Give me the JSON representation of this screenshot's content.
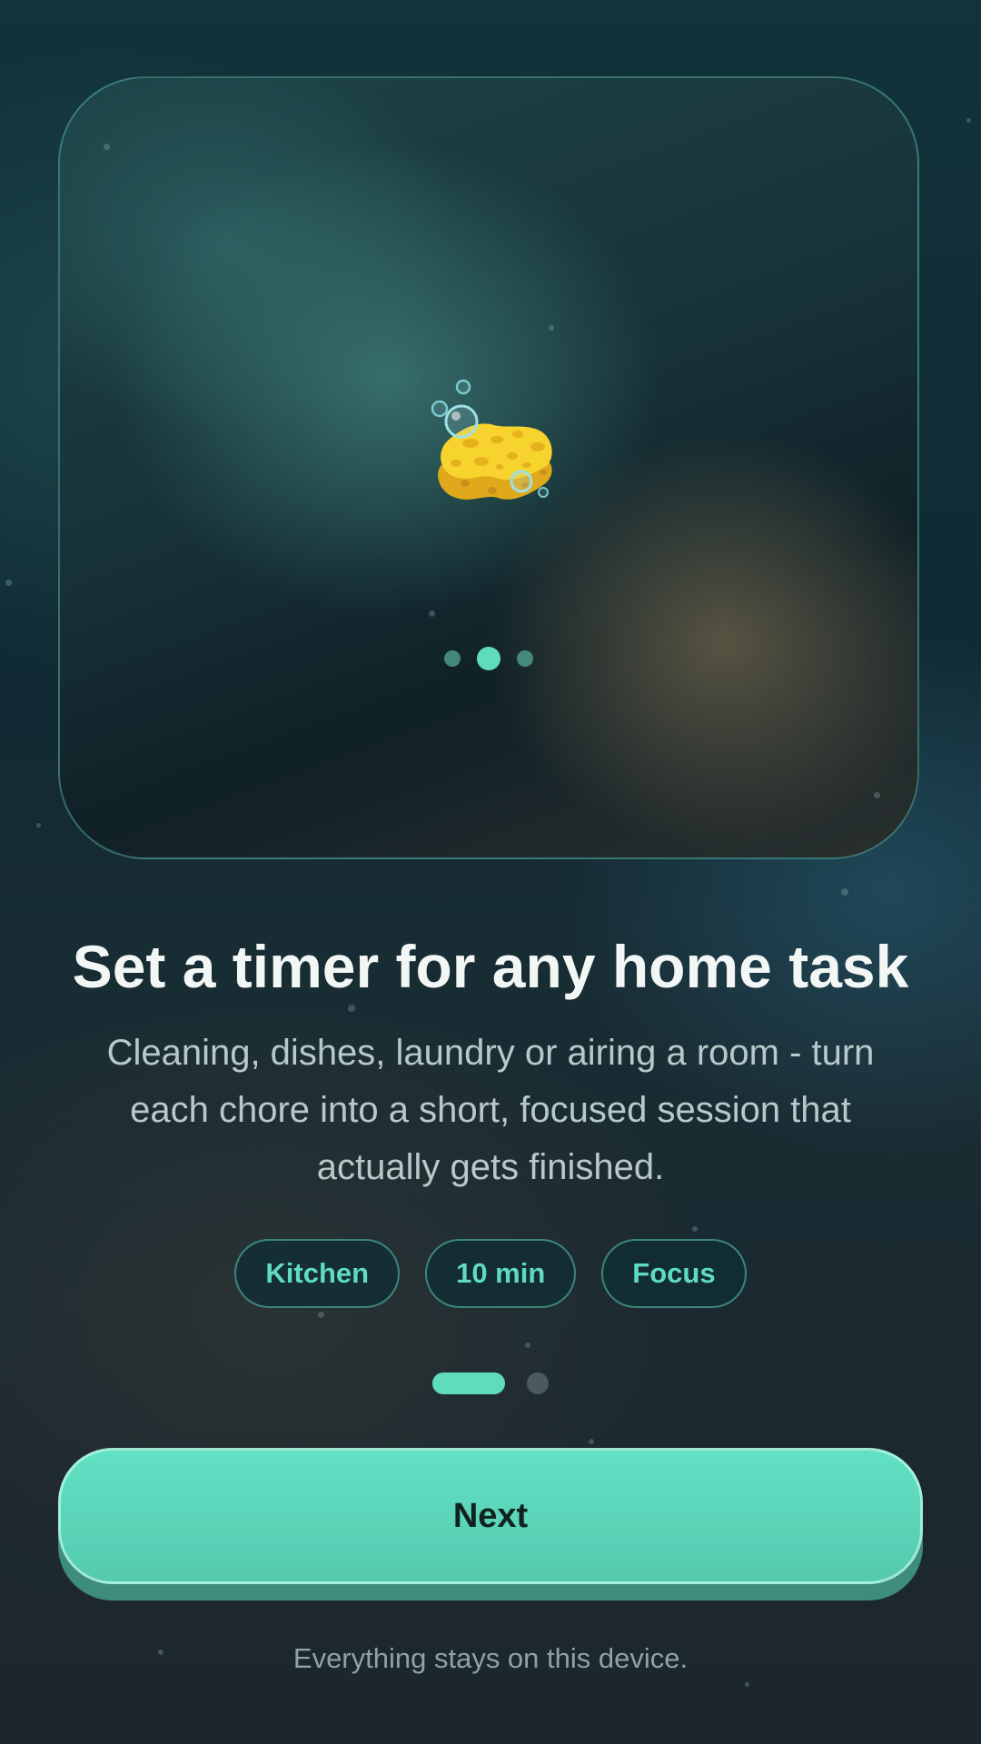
{
  "hero": {
    "icon": "sponge-with-bubbles",
    "carousel_dots": {
      "count": 3,
      "active_index": 1
    }
  },
  "content": {
    "title": "Set a timer for any home task",
    "subtitle": "Cleaning, dishes, laundry or airing a room - turn each chore into a short, focused session that actually gets finished."
  },
  "chips": [
    {
      "label": "Kitchen"
    },
    {
      "label": "10 min"
    },
    {
      "label": "Focus"
    }
  ],
  "pager": {
    "count": 2,
    "active_index": 0
  },
  "actions": {
    "next_label": "Next"
  },
  "footer": {
    "note": "Everything stays on this device."
  },
  "colors": {
    "accent": "#5fdcbe",
    "background": "#12333a",
    "button_text": "#10231f"
  }
}
